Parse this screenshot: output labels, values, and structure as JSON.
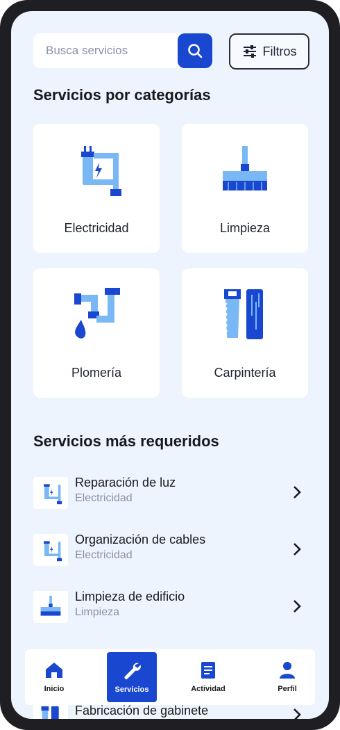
{
  "search": {
    "placeholder": "Busca servicios",
    "icon": "search-icon"
  },
  "filters": {
    "label": "Filtros",
    "icon": "sliders-icon"
  },
  "categories_section": {
    "title": "Servicios por categorías",
    "items": [
      {
        "label": "Electricidad",
        "icon": "plug-cable-icon"
      },
      {
        "label": "Limpieza",
        "icon": "broom-icon"
      },
      {
        "label": "Plomería",
        "icon": "pipe-drop-icon"
      },
      {
        "label": "Carpintería",
        "icon": "saw-wood-icon"
      }
    ]
  },
  "popular_section": {
    "title": "Servicios más requeridos",
    "items": [
      {
        "title": "Reparación de luz",
        "subtitle": "Electricidad"
      },
      {
        "title": "Organización de cables",
        "subtitle": "Electricidad"
      },
      {
        "title": "Limpieza de edificio",
        "subtitle": "Limpieza"
      },
      {
        "title": "Fabricación de gabinete",
        "subtitle": ""
      }
    ]
  },
  "bottom_nav": {
    "items": [
      {
        "label": "Inicio",
        "icon": "home-icon",
        "active": false
      },
      {
        "label": "Servicios",
        "icon": "wrench-icon",
        "active": true
      },
      {
        "label": "Actividad",
        "icon": "document-icon",
        "active": false
      },
      {
        "label": "Perfil",
        "icon": "user-icon",
        "active": false
      }
    ]
  },
  "colors": {
    "accent": "#1a47cf",
    "icon_light": "#7ab8f5",
    "background": "#eef4fd"
  }
}
